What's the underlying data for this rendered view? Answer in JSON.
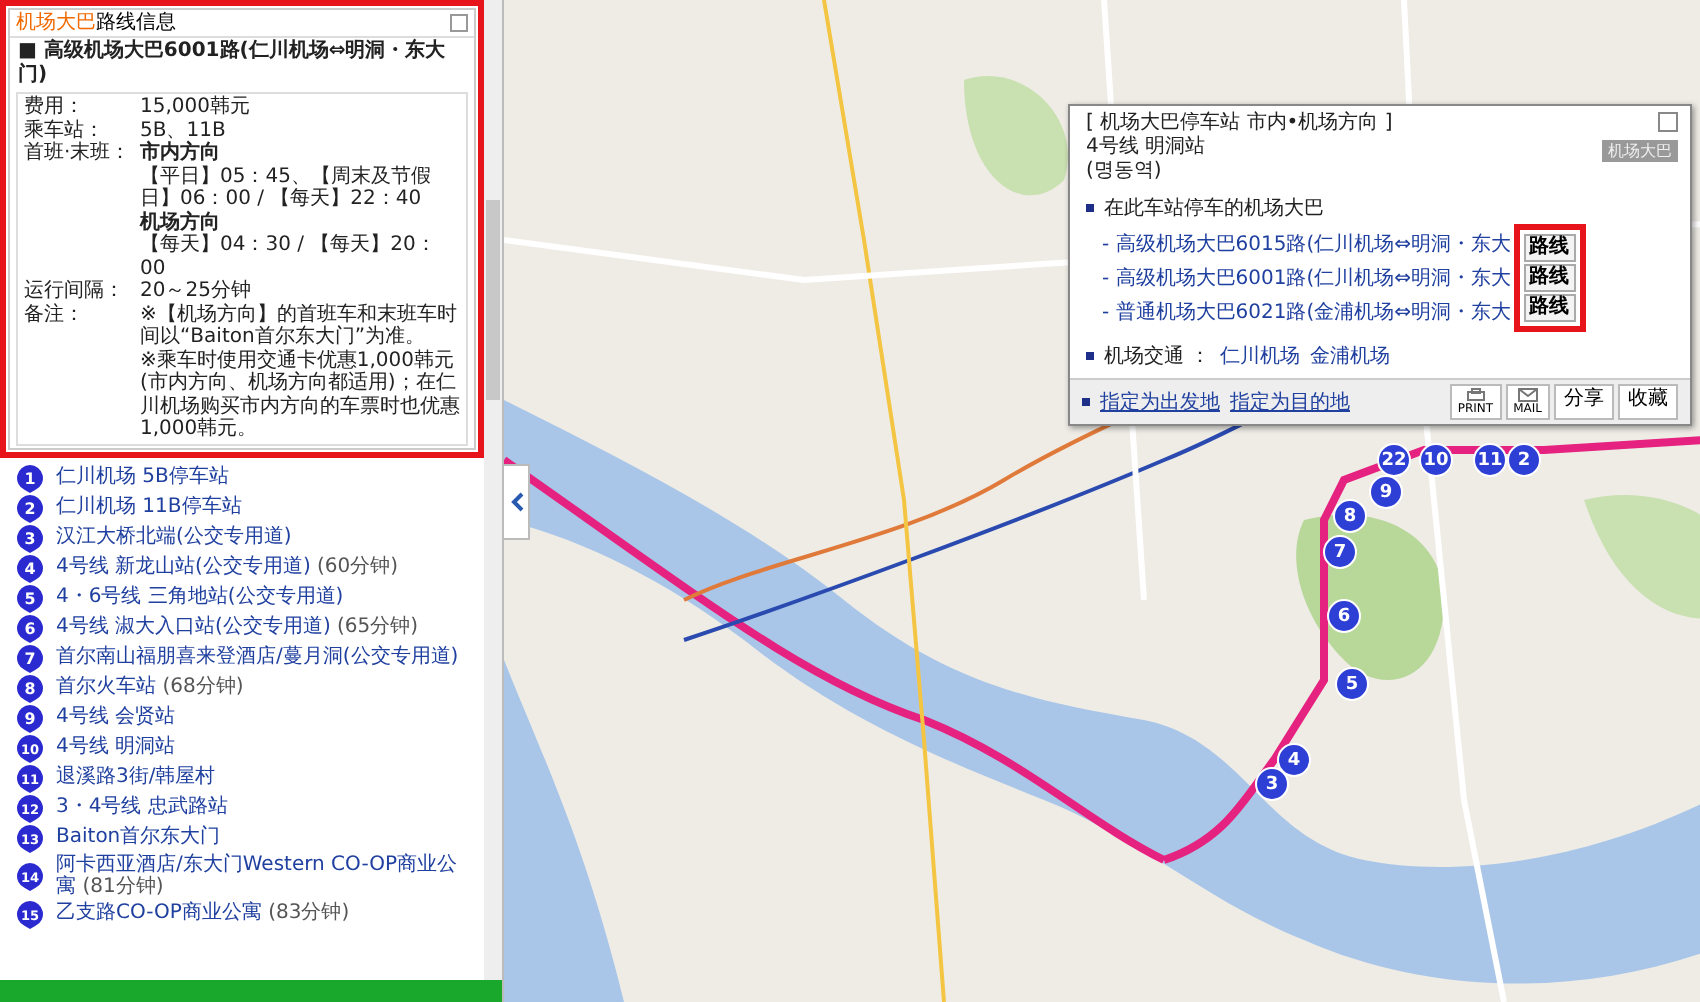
{
  "route_panel": {
    "title_highlight": "机场大巴",
    "title": "路线信息",
    "route_name": "■ 高级机场大巴6001路(仁川机场⇔明洞・东大门)",
    "details": [
      {
        "label": "费用：",
        "lines": [
          {
            "kind": "text",
            "text": "15,000韩元"
          }
        ]
      },
      {
        "label": "乘车站：",
        "lines": [
          {
            "kind": "text",
            "text": "5B、11B"
          }
        ]
      },
      {
        "label": "首班·末班：",
        "lines": [
          {
            "kind": "heading",
            "text": "市内方向"
          },
          {
            "kind": "text",
            "text": "【平日】05：45、【周末及节假日】06：00 / 【每天】22：40"
          },
          {
            "kind": "heading",
            "text": "机场方向"
          },
          {
            "kind": "text",
            "text": "【每天】04：30 / 【每天】20：00"
          }
        ]
      },
      {
        "label": "运行间隔：",
        "lines": [
          {
            "kind": "text",
            "text": "20～25分钟"
          }
        ]
      },
      {
        "label": "备注：",
        "lines": [
          {
            "kind": "note",
            "text": "※【机场方向】的首班车和末班车时间以“Baiton首尔东大门”为准。"
          },
          {
            "kind": "note",
            "text": "※乘车时使用交通卡优惠1,000韩元(市内方向、机场方向都适用)；在仁川机场购买市内方向的车票时也优惠1,000韩元。"
          }
        ]
      }
    ]
  },
  "stops": [
    {
      "number": "1",
      "name": "仁川机场 5B停车站"
    },
    {
      "number": "2",
      "name": "仁川机场 11B停车站"
    },
    {
      "number": "3",
      "name": "汉江大桥北端(公交专用道)"
    },
    {
      "number": "4",
      "name": "4号线 新龙山站(公交专用道)",
      "duration": "(60分钟)"
    },
    {
      "number": "5",
      "name": "4・6号线 三角地站(公交专用道)"
    },
    {
      "number": "6",
      "name": "4号线 淑大入口站(公交专用道)",
      "duration": "(65分钟)"
    },
    {
      "number": "7",
      "name": "首尔南山福朋喜来登酒店/蔓月洞(公交专用道)"
    },
    {
      "number": "8",
      "name": "首尔火车站",
      "duration": "(68分钟)"
    },
    {
      "number": "9",
      "name": "4号线 会贤站"
    },
    {
      "number": "10",
      "name": "4号线 明洞站"
    },
    {
      "number": "11",
      "name": "退溪路3街/韩屋村"
    },
    {
      "number": "12",
      "name": "3・4号线 忠武路站"
    },
    {
      "number": "13",
      "name": "Baiton首尔东大门"
    },
    {
      "number": "14",
      "name": "阿卡西亚酒店/东大门Western CO-OP商业公寓",
      "duration": "(81分钟)"
    },
    {
      "number": "15",
      "name": "乙支路CO-OP商业公寓",
      "duration": "(83分钟)"
    }
  ],
  "map_markers": [
    {
      "number": "22"
    },
    {
      "number": "10"
    },
    {
      "number": "11"
    },
    {
      "number": "2"
    },
    {
      "number": "9"
    },
    {
      "number": "8"
    },
    {
      "number": "7"
    },
    {
      "number": "6"
    },
    {
      "number": "5"
    },
    {
      "number": "4"
    },
    {
      "number": "3"
    }
  ],
  "stop_popup": {
    "header": "[ 机场大巴停车站 市内•机场方向 ]",
    "badge": "机场大巴",
    "station": "4号线 明洞站",
    "station_local": "(명동역)",
    "section_title": "在此车站停车的机场大巴",
    "routes": [
      {
        "name": "- 高级机场大巴6015路(仁川机场⇔明洞・东大",
        "button": "路线"
      },
      {
        "name": "- 高级机场大巴6001路(仁川机场⇔明洞・东大",
        "button": "路线"
      },
      {
        "name": "- 普通机场大巴6021路(金浦机场⇔明洞・东大",
        "button": "路线"
      }
    ],
    "transport_label": "机场交通 ：",
    "transport_links": [
      "仁川机场",
      "金浦机场"
    ],
    "footer_links": [
      "指定为出发地",
      "指定为目的地"
    ],
    "actions": [
      {
        "kind": "print",
        "label": "PRINT"
      },
      {
        "kind": "mail",
        "label": "MAIL"
      },
      {
        "kind": "text",
        "label": "分享"
      },
      {
        "kind": "text",
        "label": "收藏"
      }
    ]
  }
}
